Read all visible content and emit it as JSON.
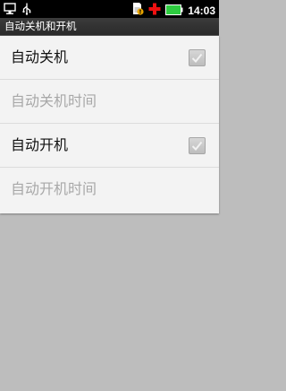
{
  "status_bar": {
    "time": "14:03",
    "icons": [
      "monitor-icon",
      "usb-icon",
      "sim-warning-icon",
      "red-cross-icon",
      "battery-icon"
    ],
    "battery_color": "#2ecc40",
    "cross_color": "#e11"
  },
  "title_bar": {
    "title": "自动关机和开机"
  },
  "settings": [
    {
      "label": "自动关机",
      "enabled": true,
      "checked": true
    },
    {
      "label": "自动关机时间",
      "enabled": false
    },
    {
      "label": "自动开机",
      "enabled": true,
      "checked": true
    },
    {
      "label": "自动开机时间",
      "enabled": false
    }
  ]
}
